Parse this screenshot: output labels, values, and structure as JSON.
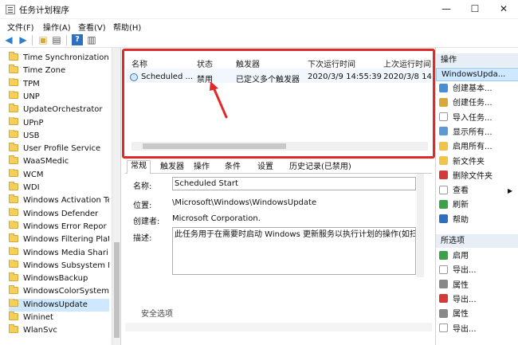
{
  "window": {
    "title": "任务计划程序",
    "minimize": "—",
    "maximize": "☐",
    "close": "✕"
  },
  "menu": [
    "文件(F)",
    "操作(A)",
    "查看(V)",
    "帮助(H)"
  ],
  "tree": {
    "items": [
      "Time Synchronization",
      "Time Zone",
      "TPM",
      "UNP",
      "UpdateOrchestrator",
      "UPnP",
      "USB",
      "User Profile Service",
      "WaaSMedic",
      "WCM",
      "WDI",
      "Windows Activation Te",
      "Windows Defender",
      "Windows Error Repor",
      "Windows Filtering Plat",
      "Windows Media Shari",
      "Windows Subsystem F",
      "WindowsBackup",
      "WindowsColorSystem",
      "WindowsUpdate",
      "Wininet",
      "WlanSvc"
    ],
    "selected_index": 19
  },
  "task_list": {
    "columns": [
      "名称",
      "状态",
      "触发器",
      "下次运行时间",
      "上次运行时间"
    ],
    "row": {
      "name": "Scheduled ...",
      "status": "禁用",
      "trigger": "已定义多个触发器",
      "next_run": "2020/3/9 14:55:39",
      "last_run": "2020/3/8 14"
    }
  },
  "tabs": [
    "常规",
    "触发器",
    "操作",
    "条件",
    "设置",
    "历史记录(已禁用)"
  ],
  "active_tab_index": 0,
  "detail": {
    "name_label": "名称:",
    "name_value": "Scheduled Start",
    "location_label": "位置:",
    "location_value": "\\Microsoft\\Windows\\WindowsUpdate",
    "author_label": "创建者:",
    "author_value": "Microsoft Corporation.",
    "description_label": "描述:",
    "description_value": "此任务用于在需要时启动 Windows 更新服务以执行计划的操作(如扫",
    "cut_label": "安全选项"
  },
  "actions": {
    "header1": "操作",
    "selected1": "WindowsUpda...",
    "group1": [
      {
        "label": "创建基本...",
        "icon": "create-basic-task-icon",
        "color": "#4a8fd4"
      },
      {
        "label": "创建任务...",
        "icon": "create-task-icon",
        "color": "#d9a83a"
      },
      {
        "label": "导入任务...",
        "icon": "import-task-icon",
        "color": "#ffffff"
      },
      {
        "label": "显示所有...",
        "icon": "show-running-icon",
        "color": "#5b9bd5"
      },
      {
        "label": "启用所有...",
        "icon": "enable-history-icon",
        "color": "#f1c34a"
      },
      {
        "label": "新文件夹",
        "icon": "new-folder-icon",
        "color": "#f1c34a"
      },
      {
        "label": "删除文件夹",
        "icon": "delete-folder-icon",
        "color": "#d33b3b"
      },
      {
        "label": "查看",
        "icon": "view-icon",
        "color": "#ffffff"
      },
      {
        "label": "刷新",
        "icon": "refresh-icon",
        "color": "#3aa34a"
      },
      {
        "label": "帮助",
        "icon": "help-icon",
        "color": "#2f6fc0"
      }
    ],
    "header2": "所选项",
    "group2": [
      {
        "label": "启用",
        "icon": "enable-icon",
        "color": "#3aa34a"
      },
      {
        "label": "导出...",
        "icon": "export-icon",
        "color": "#ffffff"
      },
      {
        "label": "属性",
        "icon": "properties-icon",
        "color": "#888888"
      },
      {
        "label": "导出...",
        "icon": "export-icon-2",
        "color": "#d33b3b"
      },
      {
        "label": "属性",
        "icon": "properties-icon-2",
        "color": "#888888"
      },
      {
        "label": "导出...",
        "icon": "export-icon-3",
        "color": "#ffffff"
      }
    ]
  },
  "accent": "#e02a2a"
}
